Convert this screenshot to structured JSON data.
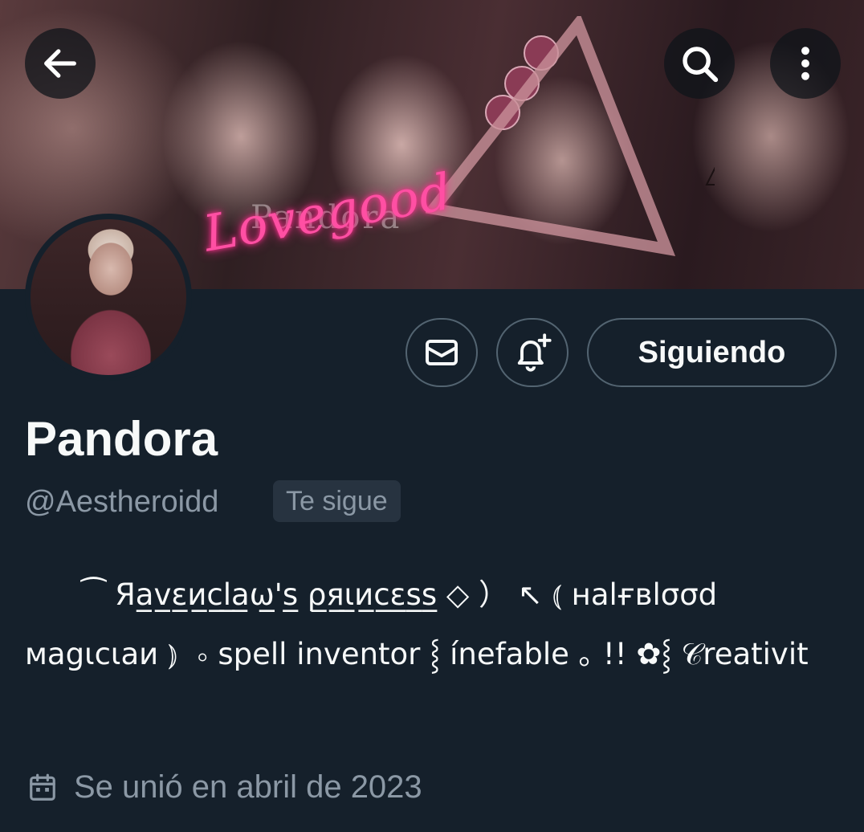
{
  "banner": {
    "neon_text": "Lovegood",
    "overlay_text": "Pandora"
  },
  "topbar": {
    "back_icon": "arrow-left-icon",
    "search_icon": "search-icon",
    "more_icon": "more-vertical-icon"
  },
  "actions": {
    "message_icon": "mail-icon",
    "notify_icon": "bell-plus-icon",
    "follow_label": "Siguiendo"
  },
  "profile": {
    "display_name": "Pandora",
    "handle": "@Aestheroidd",
    "follows_you_badge": "Te sigue",
    "bio": "      ⁀ Яa̲v̲ɛ̲и̲c̲l̲a̲ω̲'s̲ ρ̲я̲ι̲и̲c̲ɛ̲s̲s̲ ◇ ） ↖ ⦅ нalғвlσσd мagιcιaи ⦆  ⸰ spell inventor ⸾ ínefable ｡ !! ✿⸾ 𝒞reativit",
    "joined_icon": "calendar-icon",
    "joined": "Se unió en abril de 2023"
  },
  "colors": {
    "background": "#15202b",
    "secondary_text": "#8b98a5",
    "border": "#536471",
    "badge_bg": "#273340",
    "neon_pink": "#ff4fa3"
  }
}
